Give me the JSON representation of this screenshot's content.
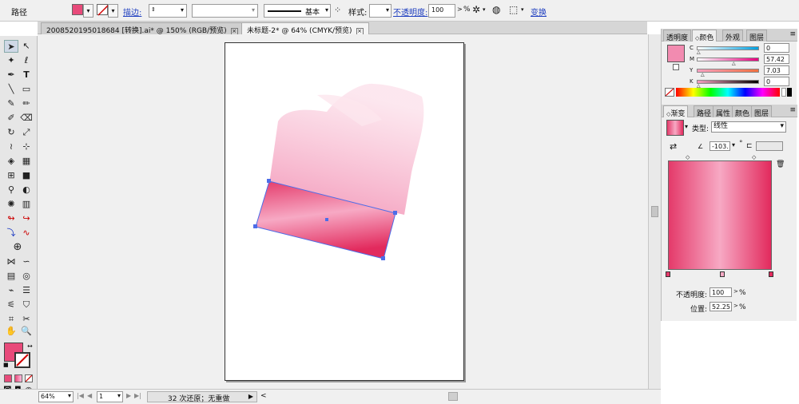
{
  "control_bar": {
    "object_type": "路径",
    "stroke_label": "描边:",
    "stroke_profile": "基本",
    "style_label": "样式:",
    "opacity_label": "不透明度:",
    "opacity_value": "100",
    "opacity_unit": "%",
    "transform_label": "变换",
    "fill_color": "#e84a7a"
  },
  "doc_tabs": [
    {
      "title": "2008520195018684 [转换].ai* @ 150% (RGB/预览)"
    },
    {
      "title": "未标题-2* @ 64% (CMYK/预览)"
    }
  ],
  "status": {
    "zoom": "64%",
    "page": "1",
    "history": "32 次还原；无重做"
  },
  "color_panel": {
    "tabs": [
      "透明度",
      "颜色",
      "外观",
      "图层"
    ],
    "sliders": [
      {
        "name": "C",
        "value": "0"
      },
      {
        "name": "M",
        "value": "57.42"
      },
      {
        "name": "Y",
        "value": "7.03"
      },
      {
        "name": "K",
        "value": "0"
      }
    ]
  },
  "gradient_panel": {
    "tabs": [
      "渐变",
      "路径",
      "属性",
      "颜色",
      "图层"
    ],
    "type_label": "类型:",
    "type_value": "线性",
    "angle_value": "-103.",
    "angle_unit": "°",
    "opacity_label": "不透明度:",
    "opacity_value": "100",
    "opacity_unit": "%",
    "location_label": "位置:",
    "location_value": "52.25",
    "location_unit": "%"
  }
}
